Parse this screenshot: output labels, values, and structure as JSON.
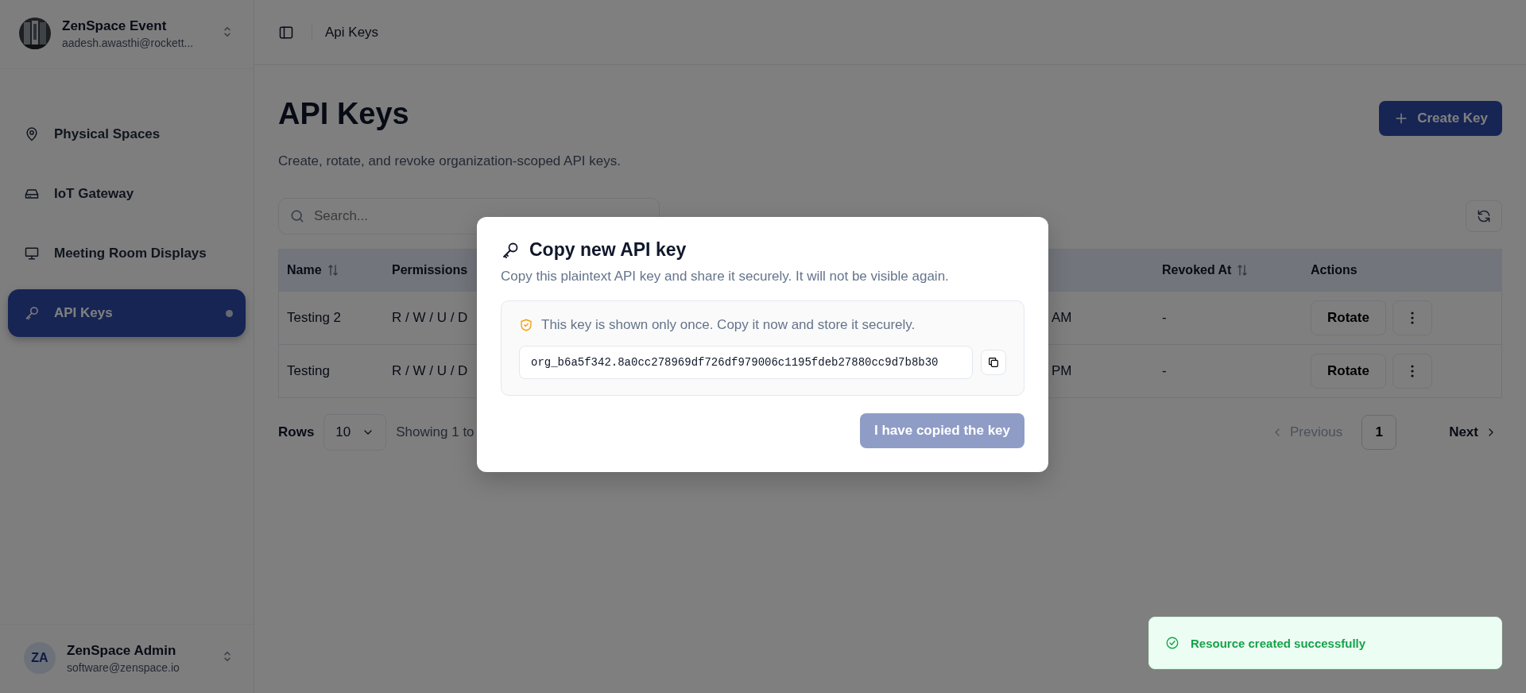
{
  "workspace": {
    "name": "ZenSpace Event",
    "email": "aadesh.awasthi@rockett..."
  },
  "sidebar": {
    "items": [
      {
        "label": "Physical Spaces",
        "selected": false
      },
      {
        "label": "IoT Gateway",
        "selected": false
      },
      {
        "label": "Meeting Room Displays",
        "selected": false
      },
      {
        "label": "API Keys",
        "selected": true
      }
    ]
  },
  "user": {
    "initials": "ZA",
    "name": "ZenSpace Admin",
    "email": "software@zenspace.io"
  },
  "breadcrumb": "Api Keys",
  "page": {
    "title": "API Keys",
    "subtitle": "Create, rotate, and revoke organization-scoped API keys.",
    "create_button": "Create Key",
    "search_placeholder": "Search..."
  },
  "table": {
    "columns": [
      {
        "kind": "text",
        "label": "Name",
        "sortable": true
      },
      {
        "kind": "text",
        "label": "Permissions",
        "sortable": false
      },
      {
        "kind": "text"
      },
      {
        "kind": "text",
        "label": "Revoked At",
        "sortable": true
      },
      {
        "kind": "actions",
        "label": "Actions",
        "sortable": false
      }
    ],
    "rows": [
      {
        "cells": [
          "Testing 2",
          "R / W / U / D",
          "AM",
          "-",
          "Rotate"
        ]
      },
      {
        "cells": [
          "Testing",
          "R / W / U / D",
          "PM",
          "-",
          "Rotate"
        ]
      }
    ]
  },
  "pagination": {
    "rows_label": "Rows",
    "page_size": "10",
    "showing": "Showing 1 to",
    "previous": "Previous",
    "previous_disabled": true,
    "pages": [
      {
        "label": "1",
        "selected": true
      }
    ],
    "next": "Next"
  },
  "modal": {
    "title": "Copy new API key",
    "description": "Copy this plaintext API key and share it securely. It will not be visible again.",
    "warning": "This key is shown only once. Copy it now and store it securely.",
    "key": "org_b6a5f342.8a0cc278969df726df979006c1195fdeb27880cc9d7b8b30",
    "confirm_button": "I have copied the key",
    "confirm_disabled": true
  },
  "toast": {
    "kind": "success",
    "message": "Resource created successfully"
  }
}
